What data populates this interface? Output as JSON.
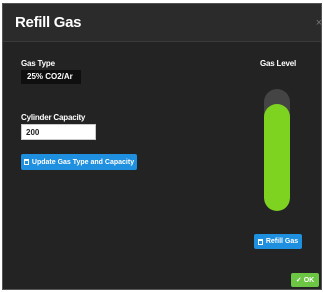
{
  "dialog": {
    "title": "Refill Gas",
    "close_glyph": "×"
  },
  "gas_type": {
    "label": "Gas Type",
    "value": "25% CO2/Ar"
  },
  "cylinder_capacity": {
    "label": "Cylinder Capacity",
    "value": "200"
  },
  "update_button": {
    "label": "Update Gas Type and Capacity",
    "icon": "trash-icon"
  },
  "gas_level": {
    "label": "Gas Level",
    "fill_fraction": 0.88,
    "fill_color": "#7ed321",
    "track_color": "#444444"
  },
  "refill_button": {
    "label": "Refill Gas",
    "icon": "trash-icon"
  },
  "ok_button": {
    "label": "OK",
    "icon": "check-icon",
    "color": "#6cc644"
  },
  "colors": {
    "accent_blue": "#1f8fe0",
    "background": "#232323"
  }
}
